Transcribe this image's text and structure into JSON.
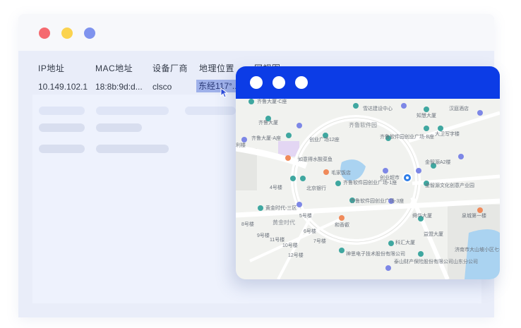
{
  "colors": {
    "accent": "#0c3ce6",
    "highlight": "#9fb1ea",
    "window_bg": "#e9edf9"
  },
  "table": {
    "headers": [
      "IP地址",
      "MAC地址",
      "设备厂商",
      "地理位置",
      "网视图"
    ],
    "row": {
      "ip": "10.149.102.1",
      "mac": "18:8b:9d:d...",
      "vendor": "clsco",
      "location": "东经117°..."
    }
  },
  "map": {
    "labels": {
      "tl_top": "齐鲁大厦-C座",
      "a1": "齐鲁大厦",
      "a2": "齐鲁大厦-A座",
      "a3": "创业广场12座",
      "a4": "如意得水酸菜鱼",
      "a5": "毛家饭店",
      "a6": "北京银行",
      "a7": "齐鲁软件园创业广场-1座",
      "a8": "齐鲁软件园创业广场-3座",
      "a9": "黄金时代-三区",
      "a10": "黄金时代",
      "a11": "和香叡",
      "a12": "11号楼",
      "a13": "10号楼",
      "a14": "9号楼",
      "a15": "8号楼",
      "a16": "4号楼",
      "a17": "5号楼",
      "a18": "6号楼",
      "a19": "7号楼",
      "a20": "12号楼",
      "a21": "神思电子技术股份有限公司",
      "a22": "泰山财产保险股份有限公司山东分公司",
      "a23": "科汇大厦",
      "a24": "益盟大厦",
      "a25": "舜华大厦",
      "a26": "泉城第一楼",
      "a27": "济南市大山坡小区七号楼",
      "a28": "金智源文化创意产业园",
      "a29": "金智源A2楼",
      "a30": "大卫写字楼",
      "a31": "汉庭酒店",
      "a32": "知慧大厦",
      "a33": "雪达建设中心",
      "a34": "齐鲁软件园",
      "a35": "齐鲁软件园创业广场-B座",
      "a36": "创业超市",
      "a37": "利楼"
    }
  }
}
